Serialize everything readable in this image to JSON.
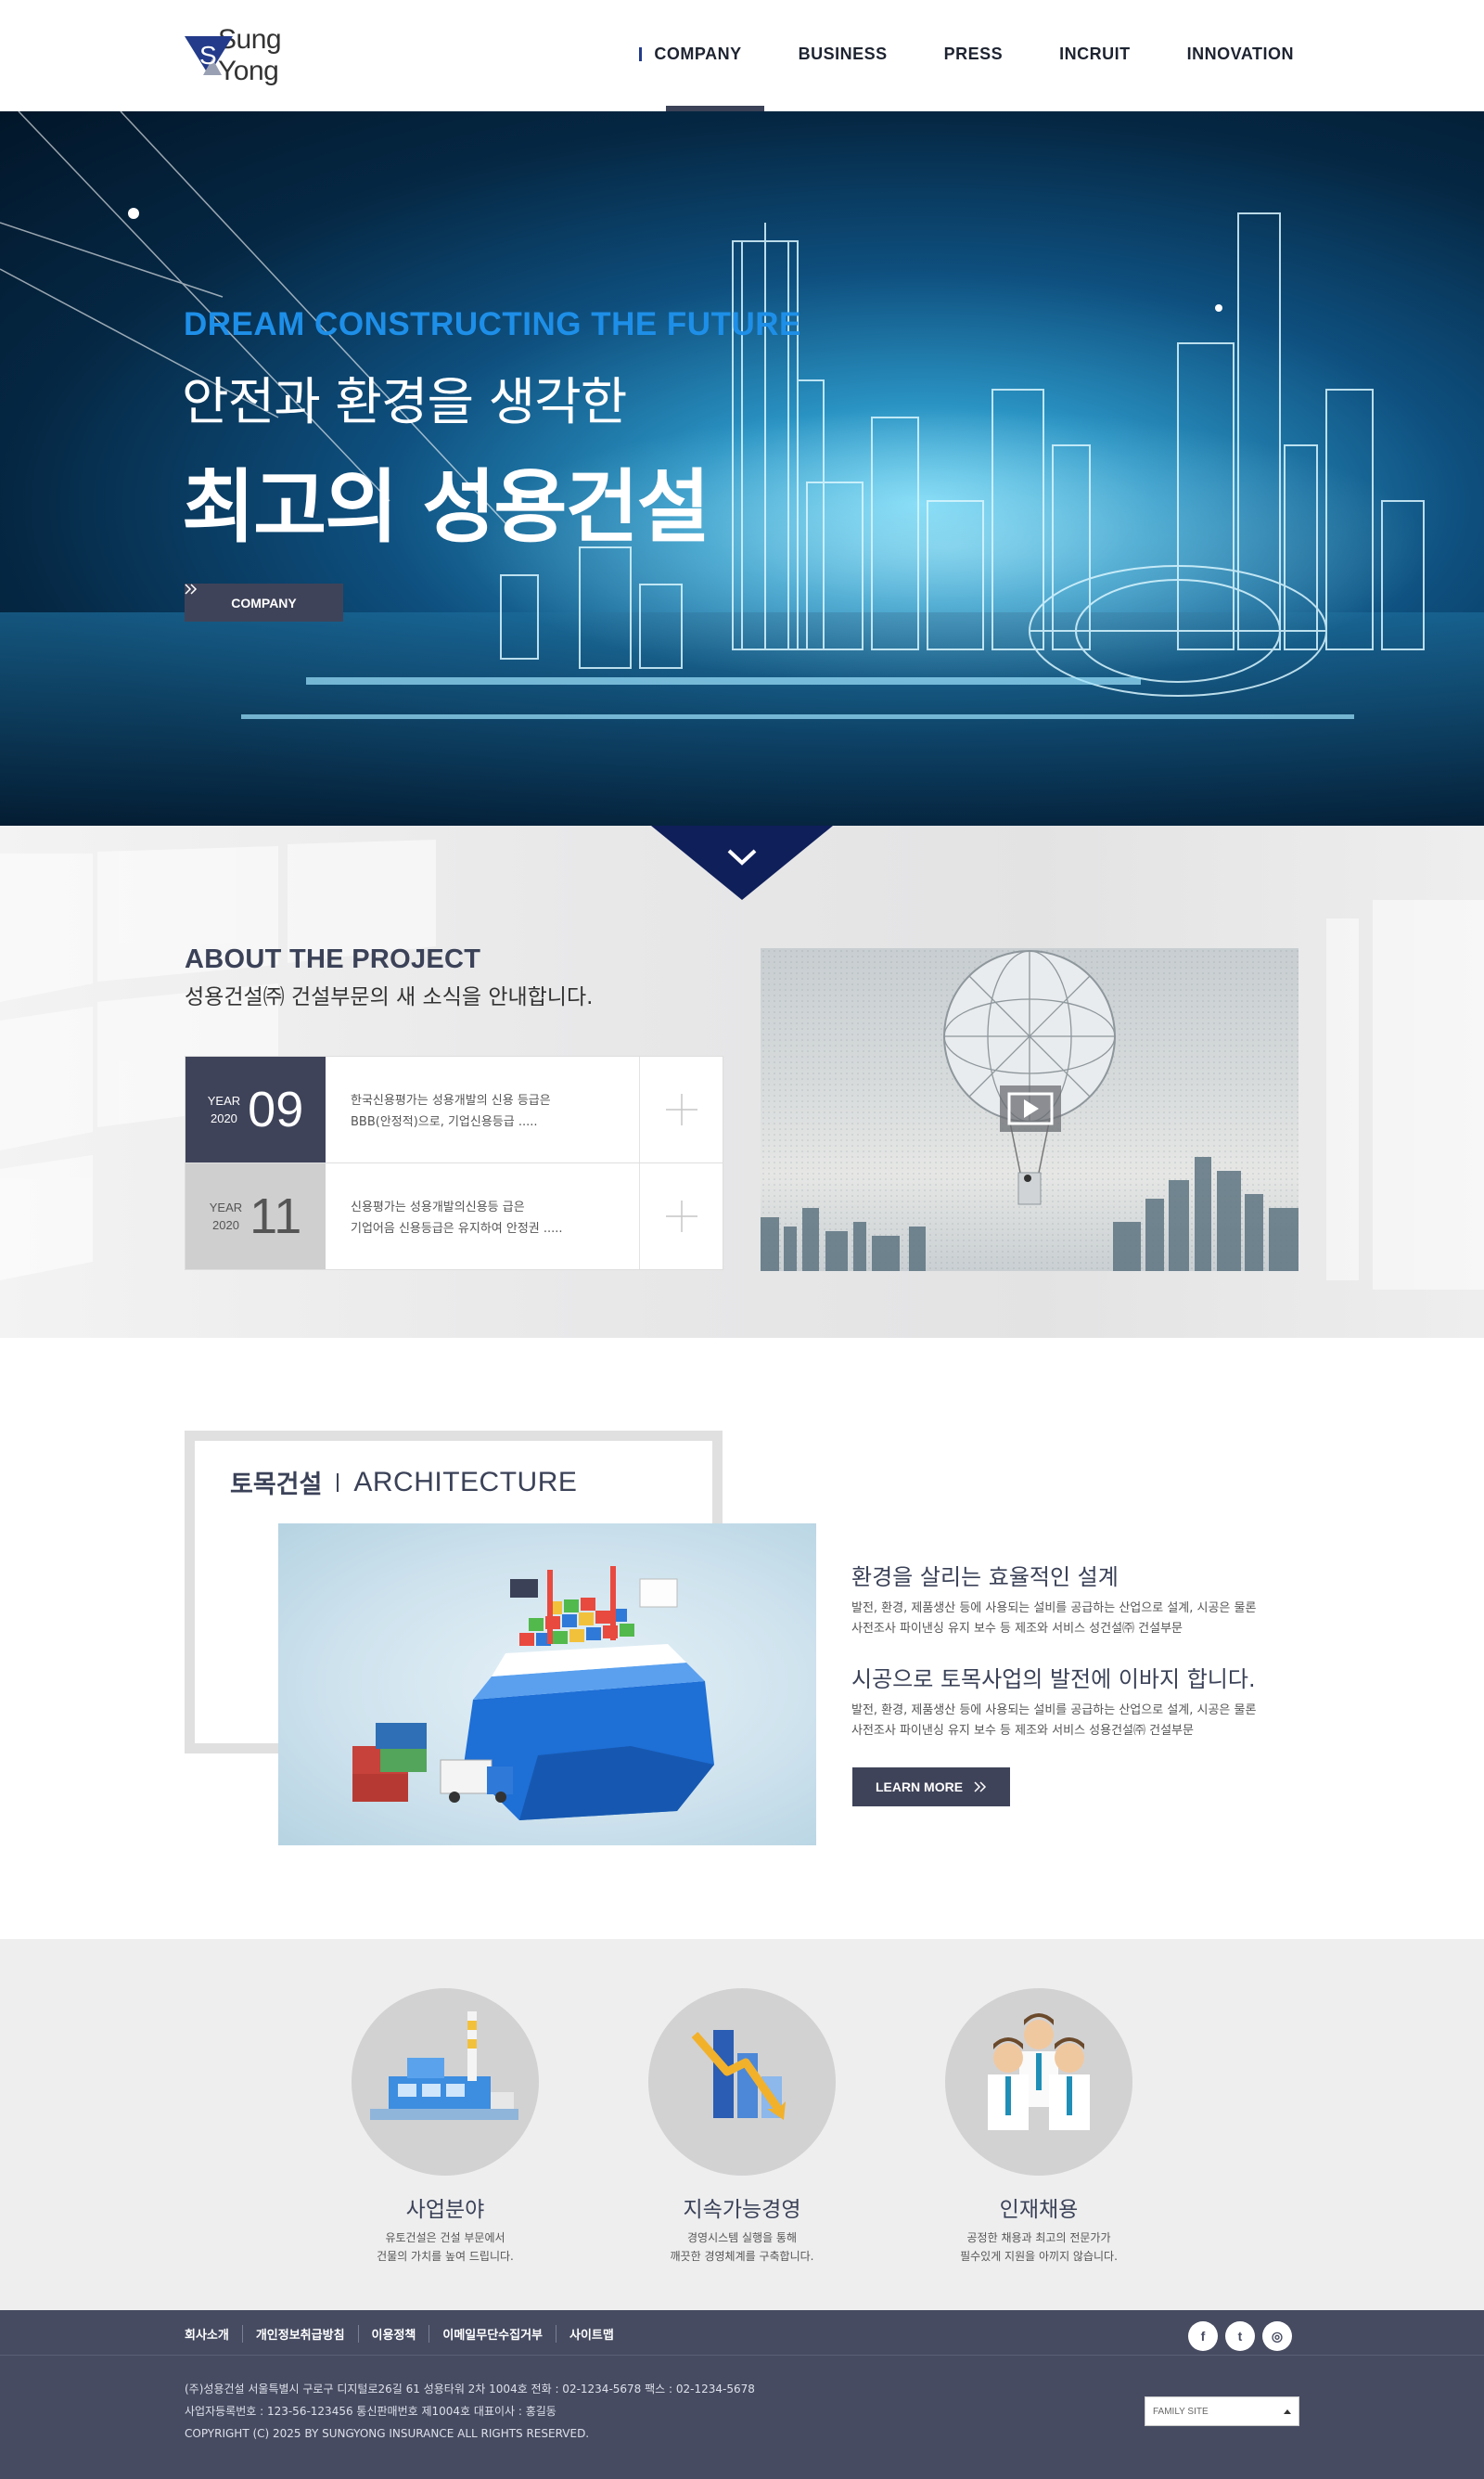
{
  "brand": {
    "logo_text": "Sung Yong"
  },
  "nav": {
    "items": [
      "COMPANY",
      "BUSINESS",
      "PRESS",
      "INCRUIT",
      "INNOVATION"
    ],
    "active": "COMPANY"
  },
  "hero": {
    "subtitle": "DREAM CONSTRUCTING THE FUTURE",
    "line1": "안전과 환경을 생각한",
    "line2": "최고의 성용건설",
    "button_label": "COMPANY"
  },
  "about": {
    "title": "ABOUT THE PROJECT",
    "description": "성용건설㈜ 건설부문의 새 소식을 안내합니다.",
    "news": [
      {
        "year_label": "YEAR",
        "year": "2020",
        "day": "09",
        "line1": "한국신용평가는 성용개발의 신용 등급은",
        "line2": "BBB(안정적)으로, 기업신용등급 ....."
      },
      {
        "year_label": "YEAR",
        "year": "2020",
        "day": "11",
        "line1": "신용평가는 성용개발의신용등 급은",
        "line2": "기업어음 신용등급은 유지하여 안정권 ....."
      }
    ]
  },
  "architecture": {
    "title_ko": "토목건설",
    "title_en": "ARCHITECTURE",
    "heading1": "환경을 살리는 효율적인 설계",
    "p1_line1": "발전, 환경, 제품생산 등에 사용되는 설비를 공급하는 산업으로 설계, 시공은 물론",
    "p1_line2": "사전조사 파이낸싱 유지 보수 등 제조와 서비스 성건설㈜ 건설부문",
    "heading2": "시공으로 토목사업의 발전에 이바지 합니다.",
    "p2_line1": "발전, 환경, 제품생산 등에 사용되는 설비를 공급하는 산업으로 설계, 시공은 물론",
    "p2_line2": "사전조사 파이낸싱 유지 보수 등 제조와 서비스 성용건설㈜ 건설부문",
    "button_label": "LEARN MORE"
  },
  "services": [
    {
      "title": "사업분야",
      "desc1": "유토건설은 건설 부문에서",
      "desc2": "건물의 가치를 높여 드립니다.",
      "icon": "factory-icon"
    },
    {
      "title": "지속가능경영",
      "desc1": "경영시스템 실행을 통해",
      "desc2": "깨끗한 경영체계를 구축합니다.",
      "icon": "chart-icon"
    },
    {
      "title": "인재채용",
      "desc1": "공정한 채용과 최고의 전문가가",
      "desc2": "필수있게 지원을 아끼지 않습니다.",
      "icon": "people-icon"
    }
  ],
  "footer": {
    "links": [
      "회사소개",
      "개인정보취급방침",
      "이용정책",
      "이메일무단수집거부",
      "사이트맵"
    ],
    "socials": [
      "facebook-icon",
      "twitter-icon",
      "instagram-icon"
    ],
    "social_glyphs": [
      "f",
      "t",
      "◎"
    ],
    "info_line1": "(주)성용건설 서울특별시 구로구 디지털로26길 61 성용타워 2차 1004호    전화 : 02-1234-5678    팩스 : 02-1234-5678",
    "info_line2": "사업자등록번호 : 123-56-123456    통신판매번호 제1004호    대표이사 : 홍길동",
    "copyright": "COPYRIGHT (C) 2025 BY SUNGYONG INSURANCE ALL RIGHTS RESERVED.",
    "family_site": "FAMILY SITE"
  },
  "colors": {
    "navy": "#3f4359",
    "accent_blue": "#1e8fe8",
    "dark_navy": "#0f1f5a",
    "footer": "#464b61"
  }
}
